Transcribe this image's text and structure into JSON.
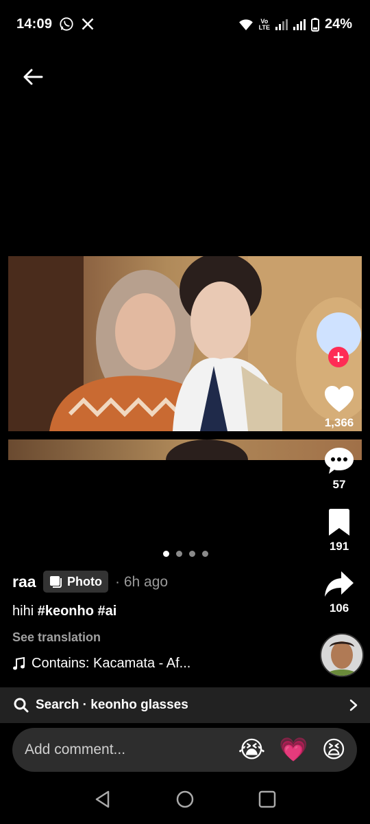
{
  "status_bar": {
    "time": "14:09",
    "battery": "24%",
    "volte_line1": "Vo",
    "volte_line2": "LTE"
  },
  "post": {
    "author": "raa",
    "badge_label": "Photo",
    "time_ago": "· 6h ago",
    "caption_text": "hihi",
    "hashtags": [
      "#keonho",
      "#ai"
    ],
    "see_translation": "See translation",
    "music": "Contains: Kacamata - Af...",
    "carousel": {
      "count": 4,
      "active_index": 0
    }
  },
  "rail": {
    "likes": "1,366",
    "comments": "57",
    "saves": "191",
    "shares": "106"
  },
  "search": {
    "label": "Search · keonho glasses"
  },
  "comment": {
    "placeholder": "Add comment...",
    "emojis": [
      "😭",
      "💗",
      "😫"
    ]
  },
  "colors": {
    "accent": "#fe2c55",
    "background": "#000000",
    "search_bg": "#222222",
    "comment_bg": "#2d2d2d"
  }
}
